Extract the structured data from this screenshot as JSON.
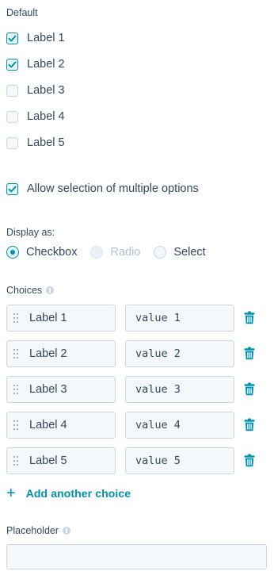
{
  "default": {
    "label": "Default",
    "options": [
      {
        "label": "Label 1",
        "checked": true
      },
      {
        "label": "Label 2",
        "checked": true
      },
      {
        "label": "Label 3",
        "checked": false
      },
      {
        "label": "Label 4",
        "checked": false
      },
      {
        "label": "Label 5",
        "checked": false
      }
    ]
  },
  "multiple": {
    "label": "Allow selection of multiple options",
    "checked": true
  },
  "display_as": {
    "label": "Display as:",
    "options": [
      {
        "label": "Checkbox",
        "state": "selected"
      },
      {
        "label": "Radio",
        "state": "disabled"
      },
      {
        "label": "Select",
        "state": "unselected"
      }
    ]
  },
  "choices": {
    "label": "Choices",
    "info_icon": "info-icon",
    "items": [
      {
        "label": "Label 1",
        "value": "value 1"
      },
      {
        "label": "Label 2",
        "value": "value 2"
      },
      {
        "label": "Label 3",
        "value": "value 3"
      },
      {
        "label": "Label 4",
        "value": "value 4"
      },
      {
        "label": "Label 5",
        "value": "value 5"
      }
    ],
    "add_label": "Add another choice",
    "add_icon": "plus-icon",
    "delete_icon": "trash-icon"
  },
  "placeholder": {
    "label": "Placeholder",
    "info_icon": "info-icon",
    "value": ""
  },
  "colors": {
    "accent": "#0091ae",
    "text": "#33475b",
    "border": "#cbd6e2",
    "field_bg": "#f5f8fa",
    "disabled_text": "#b0c1d4"
  }
}
